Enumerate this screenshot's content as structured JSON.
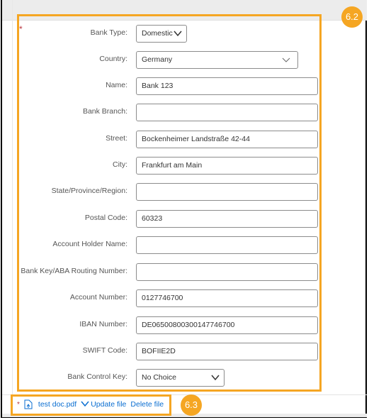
{
  "form": {
    "required_marker": "*",
    "fields": [
      {
        "label": "Bank Type:",
        "value": "Domestic",
        "type": "select"
      },
      {
        "label": "Country:",
        "value": "Germany",
        "type": "select"
      },
      {
        "label": "Name:",
        "value": "Bank 123",
        "type": "text"
      },
      {
        "label": "Bank Branch:",
        "value": "",
        "type": "text"
      },
      {
        "label": "Street:",
        "value": "Bockenheimer Landstraße 42-44",
        "type": "text"
      },
      {
        "label": "City:",
        "value": "Frankfurt am Main",
        "type": "text"
      },
      {
        "label": "State/Province/Region:",
        "value": "",
        "type": "text"
      },
      {
        "label": "Postal Code:",
        "value": "60323",
        "type": "text"
      },
      {
        "label": "Account Holder Name:",
        "value": "",
        "type": "text"
      },
      {
        "label": "Bank Key/ABA Routing Number:",
        "value": "",
        "type": "text"
      },
      {
        "label": "Account Number:",
        "value": "0127746700",
        "type": "text"
      },
      {
        "label": "IBAN Number:",
        "value": "DE06500800300147746700",
        "type": "text"
      },
      {
        "label": "SWIFT Code:",
        "value": "BOFIIE2D",
        "type": "text"
      },
      {
        "label": "Bank Control Key:",
        "value": "No Choice",
        "type": "select"
      }
    ]
  },
  "attachment": {
    "required_marker": "*",
    "file_icon": "file-upload-icon",
    "file_name": "test doc.pdf",
    "update_label": "Update file",
    "delete_label": "Delete file"
  },
  "callouts": {
    "form_badge": "6.2",
    "attachment_badge": "6.3",
    "color": "#f5a623"
  }
}
